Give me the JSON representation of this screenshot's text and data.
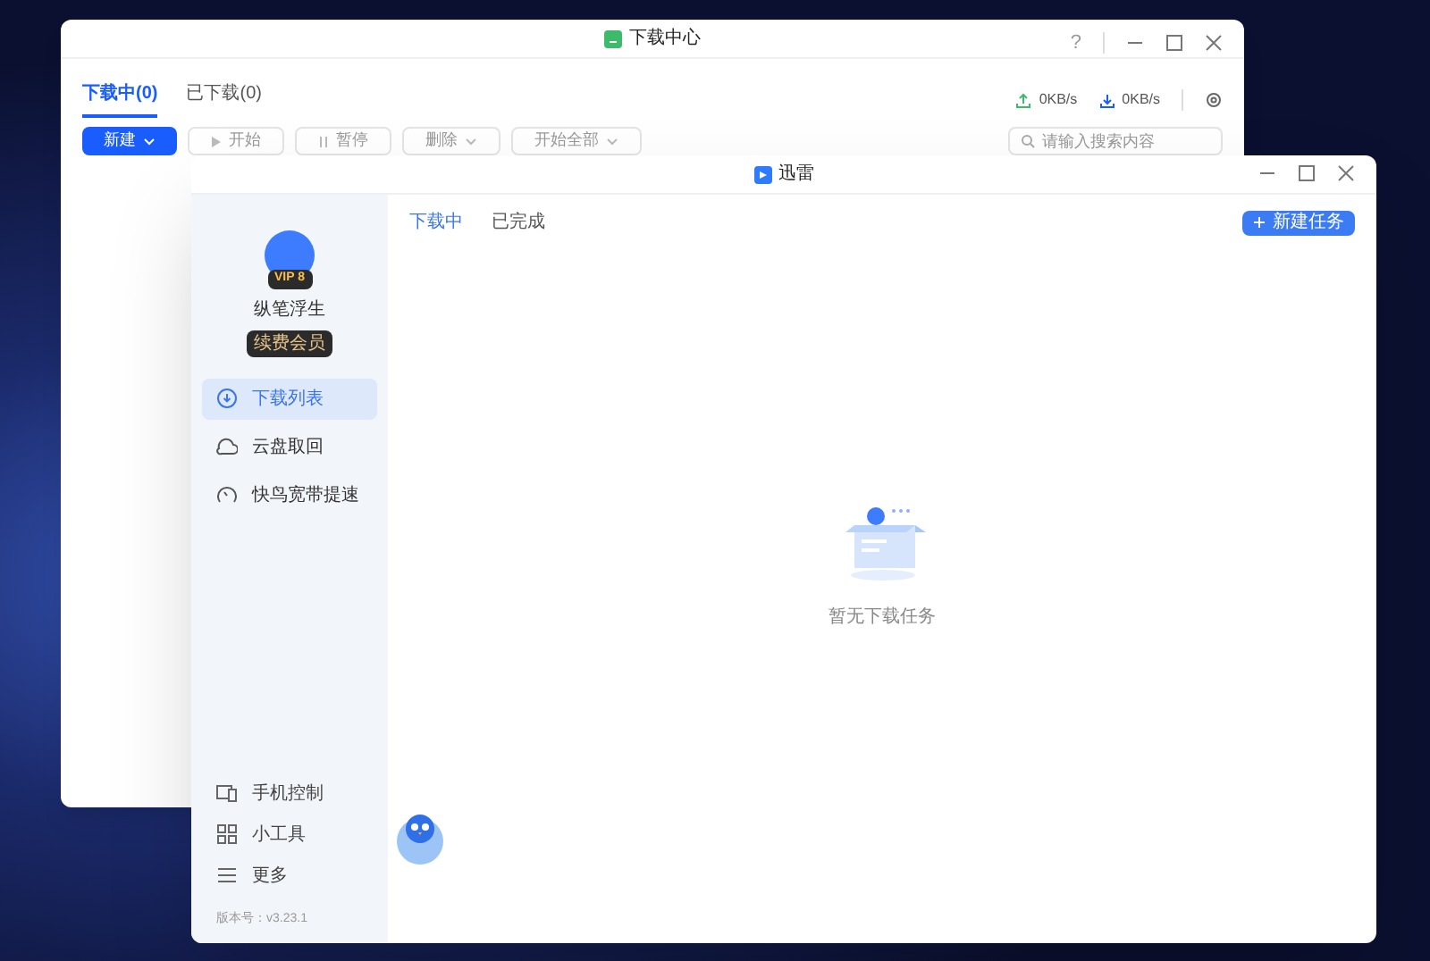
{
  "back_window": {
    "title": "下载中心",
    "help": "?",
    "tabs": [
      {
        "label": "下载中(0)",
        "selected": true
      },
      {
        "label": "已下载(0)",
        "selected": false
      }
    ],
    "speeds": [
      {
        "kind": "upload",
        "text": "0KB/s"
      },
      {
        "kind": "download",
        "text": "0KB/s"
      }
    ],
    "toolbar": [
      {
        "kind": "primary",
        "label": "新建",
        "caret": true,
        "disabled": false
      },
      {
        "kind": "play",
        "label": "开始",
        "caret": false,
        "disabled": true
      },
      {
        "kind": "pause",
        "label": "暂停",
        "caret": false,
        "disabled": true
      },
      {
        "kind": "plain",
        "label": "删除",
        "caret": true,
        "disabled": true
      },
      {
        "kind": "plain",
        "label": "开始全部",
        "caret": true,
        "disabled": true
      }
    ],
    "search": {
      "placeholder": "请输入搜索内容"
    }
  },
  "front_window": {
    "title": "迅雷",
    "user": {
      "name": "纵笔浮生",
      "vip": "VIP 8",
      "badge": "续费会员"
    },
    "sidebar": {
      "items": [
        {
          "kind": "download",
          "label": "下载列表",
          "selected": true
        },
        {
          "kind": "cloud",
          "label": "云盘取回",
          "selected": false
        },
        {
          "kind": "speed",
          "label": "快鸟宽带提速",
          "selected": false
        }
      ],
      "bottom_items": [
        {
          "kind": "phone",
          "label": "手机控制"
        },
        {
          "kind": "tools",
          "label": "小工具"
        },
        {
          "kind": "more",
          "label": "更多"
        }
      ],
      "version": "版本号：v3.23.1"
    },
    "tabs": [
      {
        "label": "下载中",
        "selected": true
      },
      {
        "label": "已完成",
        "selected": false
      }
    ],
    "new_task_button": "新建任务",
    "empty_text": "暂无下载任务"
  }
}
